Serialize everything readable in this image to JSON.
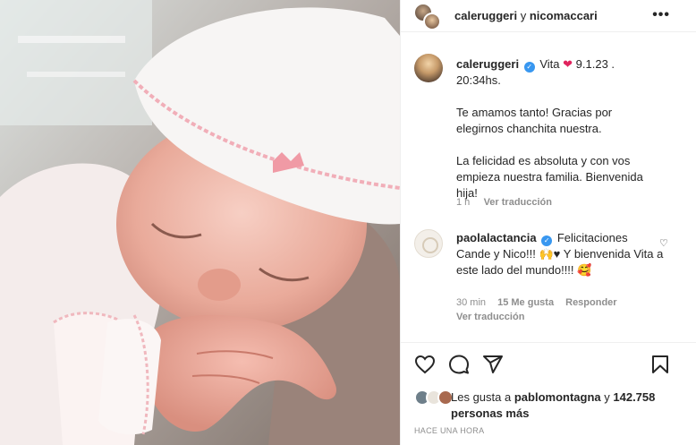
{
  "header": {
    "user1": "caleruggeri",
    "conjunction": "y",
    "user2": "nicomaccari",
    "more_label": "•••"
  },
  "caption": {
    "username": "caleruggeri",
    "verified_mark": "✓",
    "text_1": "Vita",
    "heart": "❤",
    "text_2": "9.1.23 . 20:34hs.",
    "para_1": "Te amamos tanto! Gracias por elegirnos chanchita nuestra.",
    "para_2": "La felicidad es absoluta y con vos empieza nuestra familia. Bienvenida hija!",
    "time": "1 h",
    "translate": "Ver traducción"
  },
  "comment": {
    "username": "paolalactancia",
    "verified_mark": "✓",
    "text": "Felicitaciones Cande y Nico!!! 🙌♥ Y bienvenida Vita a este lado del mundo!!!! 🥰",
    "time": "30 min",
    "likes": "15 Me gusta",
    "reply": "Responder",
    "translate": "Ver traducción"
  },
  "likes": {
    "prefix": "Les gusta a",
    "user": "pablomontagna",
    "conjunction": "y",
    "count": "142.758 personas más"
  },
  "timestamp": "HACE UNA HORA",
  "colors": {
    "verified": "#3897f0",
    "meta_gray": "#8e8e8e",
    "heart_red": "#e0245e"
  },
  "icons": [
    "heart-icon",
    "comment-icon",
    "share-icon",
    "bookmark-icon",
    "more-icon"
  ]
}
